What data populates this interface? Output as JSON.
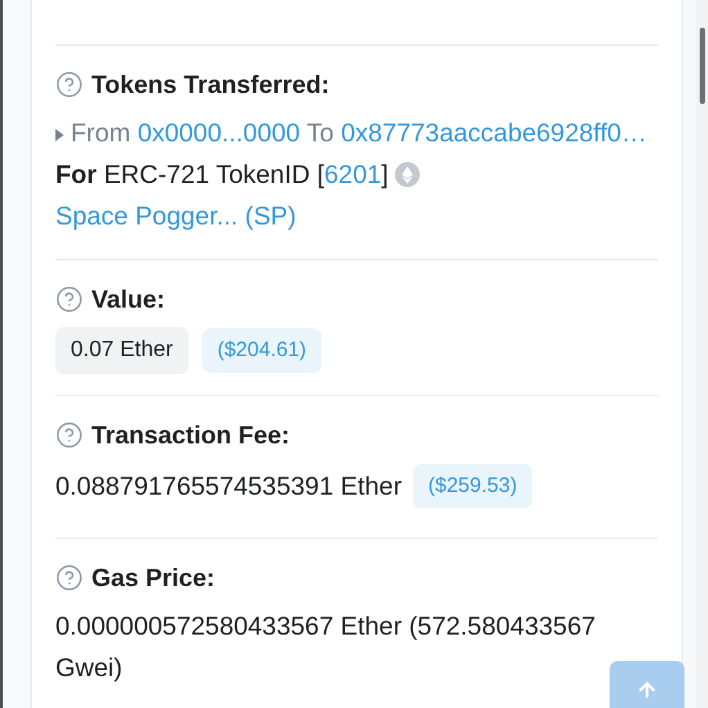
{
  "sections": [
    {
      "kind": "tokens",
      "label": "Tokens Transferred:",
      "transfer": {
        "from_label": "From",
        "from": "0x0000...0000",
        "to_label": "To",
        "to": "0x87773aaccabe6928ff0…",
        "for_label": "For",
        "standard": "ERC-721",
        "token_label": "TokenID [",
        "token_id": "6201",
        "token_close": "]",
        "token_name": "Space Pogger... (SP)"
      }
    },
    {
      "kind": "value",
      "label": "Value:",
      "amount": "0.07 Ether",
      "usd": "($204.61)"
    },
    {
      "kind": "fee",
      "label": "Transaction Fee:",
      "amount": "0.088791765574535391 Ether",
      "usd": "($259.53)"
    },
    {
      "kind": "text",
      "label": "Gas Price:",
      "text": "0.000000572580433567 Ether (572.580433567 Gwei)"
    }
  ]
}
